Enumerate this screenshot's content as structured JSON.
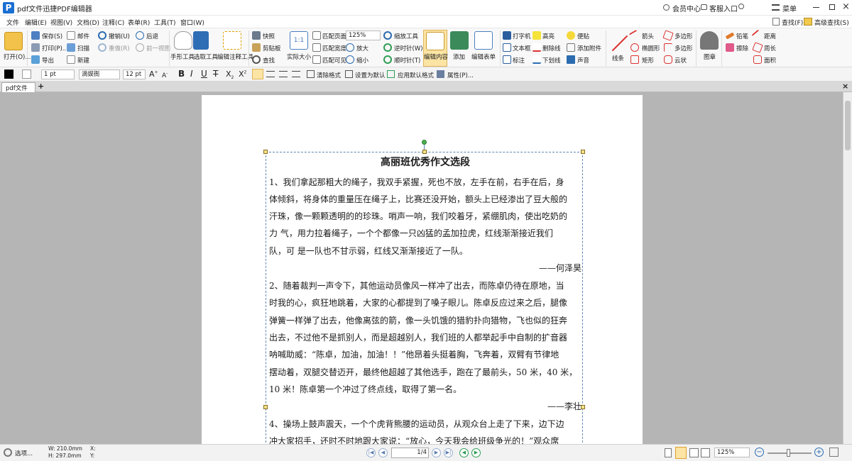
{
  "app": {
    "title": "pdf文件迅捷PDF编辑器",
    "logo_letter": "P",
    "member": "会员中心",
    "service": "客服入口",
    "menu": "菜单",
    "colors": {
      "accent": "#1b6fd1",
      "selection": "#5f86b0"
    }
  },
  "menubar": [
    "文件",
    "编辑(E)",
    "视图(V)",
    "文档(D)",
    "注释(C)",
    "表单(R)",
    "工具(T)",
    "窗口(W)"
  ],
  "ribbon": {
    "open": "打开(O)...",
    "save": "保存(S)",
    "print": "打印(P)...",
    "export": "导出",
    "mail": "邮件",
    "scan": "扫描",
    "new": "新建",
    "undo": "撤销(U)",
    "redo": "重做(R)",
    "back": "后退",
    "forward": "前一视图",
    "hand": "手形工具",
    "select": "选取工具",
    "edit_annot": "编辑注释工具",
    "snapshot": "快照",
    "clipboard": "剪贴板",
    "find": "查找",
    "actual": "实际大小",
    "fit_page": "匹配页面",
    "fit_width": "匹配宽度",
    "fit_visible": "匹配可见",
    "zoom": "125%",
    "zoom_in": "放大",
    "zoom_out": "缩小",
    "zoom_tool": "缩放工具",
    "rot_cw": "逆时针(W)",
    "rot_ccw": "顺时针(T)",
    "edit_content": "编辑内容",
    "add": "添加",
    "edit_form": "编辑表单",
    "typewriter": "打字机",
    "textbox": "文本框",
    "callout": "标注",
    "highlight": "高亮",
    "strike": "删除线",
    "underline": "下划线",
    "note": "便贴",
    "attach": "添加附件",
    "sound": "声音",
    "line": "线条",
    "arrow": "箭头",
    "ellipse": "椭圆形",
    "rect": "矩形",
    "polygon": "多边形",
    "polyline": "多边形",
    "cloud": "云状",
    "stamp": "图章",
    "pencil": "铅笔",
    "eraser": "擦除",
    "distance": "距离",
    "perimeter": "周长",
    "area": "面积",
    "search": "查找(F)",
    "adv_search": "高级查找(S)"
  },
  "format": {
    "line_width": "1 pt",
    "font": "滴娱衙",
    "font_size": "12 pt",
    "clear": "清除格式",
    "set_default": "设置为默认",
    "apply_default": "应用默认格式",
    "props": "属性(P)..."
  },
  "tab": {
    "label": "pdf文件"
  },
  "document": {
    "title": "高丽班优秀作文选段",
    "lines": [
      "1、我们拿起那粗大的绳子，我双手紧握，死也不放，左手在前，右手在后，身",
      "体倾斜，将身体的重量压在绳子上，比赛还没开始，额头上已经渗出了豆大般的",
      "汗珠，像一颗颗透明的的珍珠。哨声一响，我们咬着牙，紧绷肌肉，使出吃奶的",
      "力 气，用力拉着绳子，一个个都像一只凶猛的孟加拉虎，红线渐渐接近我们",
      "队，可 是一队也不甘示弱，红线又渐渐接近了一队。"
    ],
    "sig1": "——何泽昊",
    "lines2": [
      "2、随着裁判一声令下，其他运动员像风一样冲了出去，而陈卓仍待在原地，当",
      "时我的心，疯狂地跳着，大家的心都提到了嗓子眼儿。陈卓反应过来之后，腿像",
      "弹簧一样弹了出去，他像离弦的箭，像一头饥饿的猎豹扑向猎物，飞也似的狂奔",
      "出去，不过他不是抓别人，而是超越别人，我们班的人都举起手中自制的扩音器",
      "呐喊助威：“陈卓，加油，加油！！”他昂着头挺着胸，飞奔着，双臂有节律地",
      "摆动着，双腿交替迈开，最终他超越了其他选手，跑在了最前头，50 米，40 米，",
      "10 米！陈卓第一个冲过了终点线，取得了第一名。"
    ],
    "sig2": "——李壮",
    "lines3": [
      "4、操场上鼓声震天，一个个虎背熊腰的运动员，从观众台上走了下来，边下边",
      "冲大家招手，还时不时地跟大家说：“放心，今天我会给班级争光的！”观众席"
    ]
  },
  "status": {
    "options": "选项...",
    "width": "W: 210.0mm",
    "height": "H: 297.0mm",
    "x": "X:",
    "y": "Y:",
    "page": "1",
    "page_total": "/4",
    "zoom": "125%"
  }
}
